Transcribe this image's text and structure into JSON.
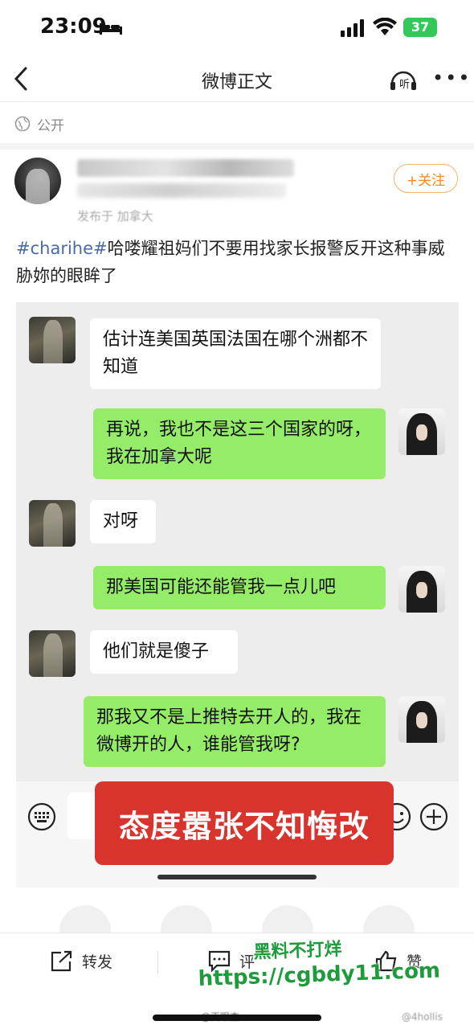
{
  "status_bar": {
    "time": "23:09",
    "battery": "37"
  },
  "nav": {
    "title": "微博正文"
  },
  "post": {
    "visibility": "公开",
    "author_name": "",
    "follow_label": "+关注",
    "meta": "发布于 加拿大",
    "hashtag": "#charihe#",
    "text": "哈喽耀祖妈们不要用找家长报警反开这种事威胁妳的眼眸了"
  },
  "chat": {
    "messages": [
      {
        "side": "left",
        "text": "估计连美国英国法国在哪个洲都不知道"
      },
      {
        "side": "right",
        "text": "再说，我也不是这三个国家的呀，我在加拿大呢"
      },
      {
        "side": "left",
        "text": "对呀"
      },
      {
        "side": "right",
        "text": "那美国可能还能管我一点儿吧"
      },
      {
        "side": "left",
        "text": "他们就是傻子"
      },
      {
        "side": "right",
        "text": "那我又不是上推特去开人的，我在微博开的人，谁能管我呀?"
      }
    ]
  },
  "caption": "态度嚣张不知悔改",
  "toolbar": {
    "repost": "转发",
    "comment": "评",
    "like": "赞"
  },
  "watermark": {
    "line1": "黑料不打烊",
    "line2": "https://cgbdy11.com"
  },
  "credits": {
    "left": "@天眼查",
    "right": "@4hollis"
  }
}
